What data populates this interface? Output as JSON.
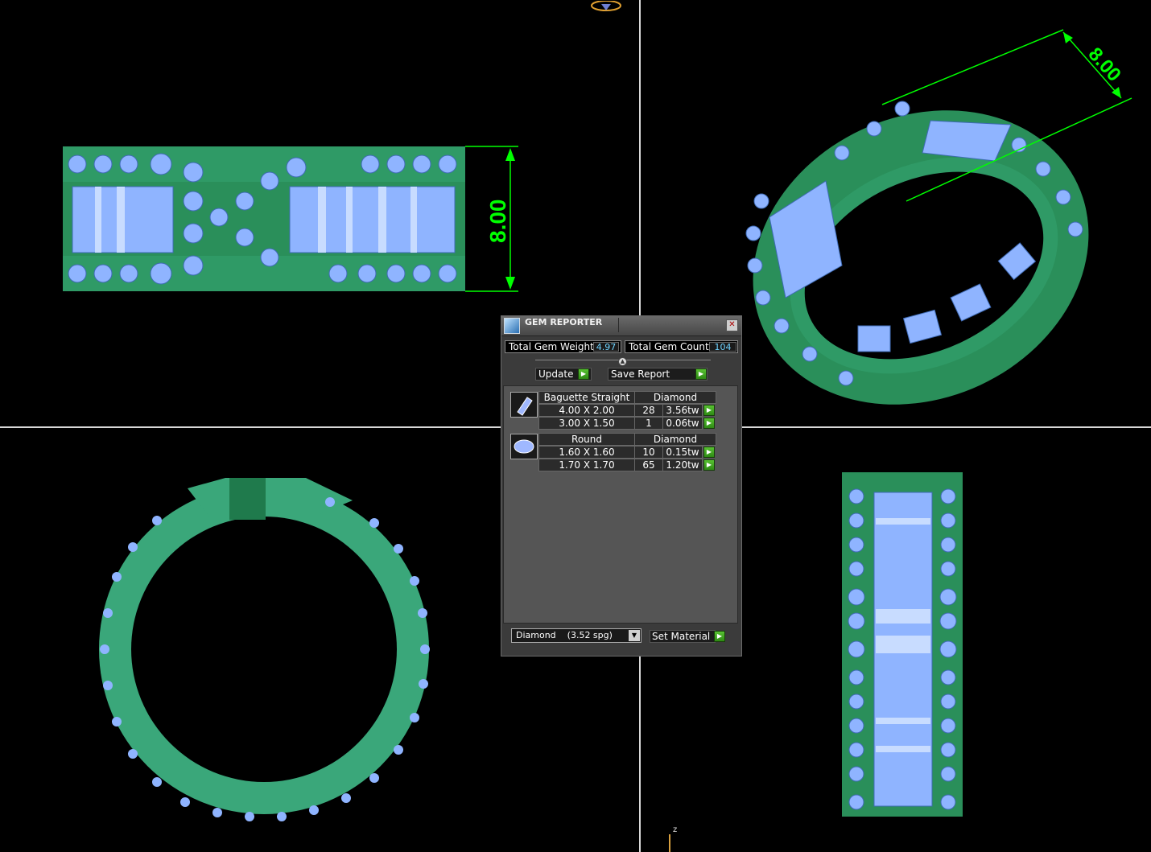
{
  "viewports": {
    "top_left": {
      "dimension": "8.00"
    },
    "top_right": {
      "dimension": "8.00"
    },
    "axis_label": "z"
  },
  "colors": {
    "metal": "#2f9a66",
    "gem": "#8fb4ff",
    "dimension": "#00ff00",
    "value_text": "#6fd3ff"
  },
  "gem_reporter": {
    "title": "GEM REPORTER",
    "close_icon": "close-icon",
    "total_gem_weight_label": "Total Gem Weight",
    "total_gem_weight": "4.97",
    "total_gem_count_label": "Total Gem Count",
    "total_gem_count": "104",
    "update_label": "Update",
    "save_report_label": "Save Report",
    "groups": [
      {
        "shape": "Baguette Straight",
        "material": "Diamond",
        "icon": "baguette-icon",
        "rows": [
          {
            "size": "4.00 X 2.00",
            "count": "28",
            "weight": "3.56tw"
          },
          {
            "size": "3.00 X 1.50",
            "count": "1",
            "weight": "0.06tw"
          }
        ]
      },
      {
        "shape": "Round",
        "material": "Diamond",
        "icon": "round-gem-icon",
        "rows": [
          {
            "size": "1.60 X 1.60",
            "count": "10",
            "weight": "0.15tw"
          },
          {
            "size": "1.70 X 1.70",
            "count": "65",
            "weight": "1.20tw"
          }
        ]
      }
    ],
    "material_select": "Diamond    (3.52 spg)",
    "set_material_label": "Set Material"
  }
}
